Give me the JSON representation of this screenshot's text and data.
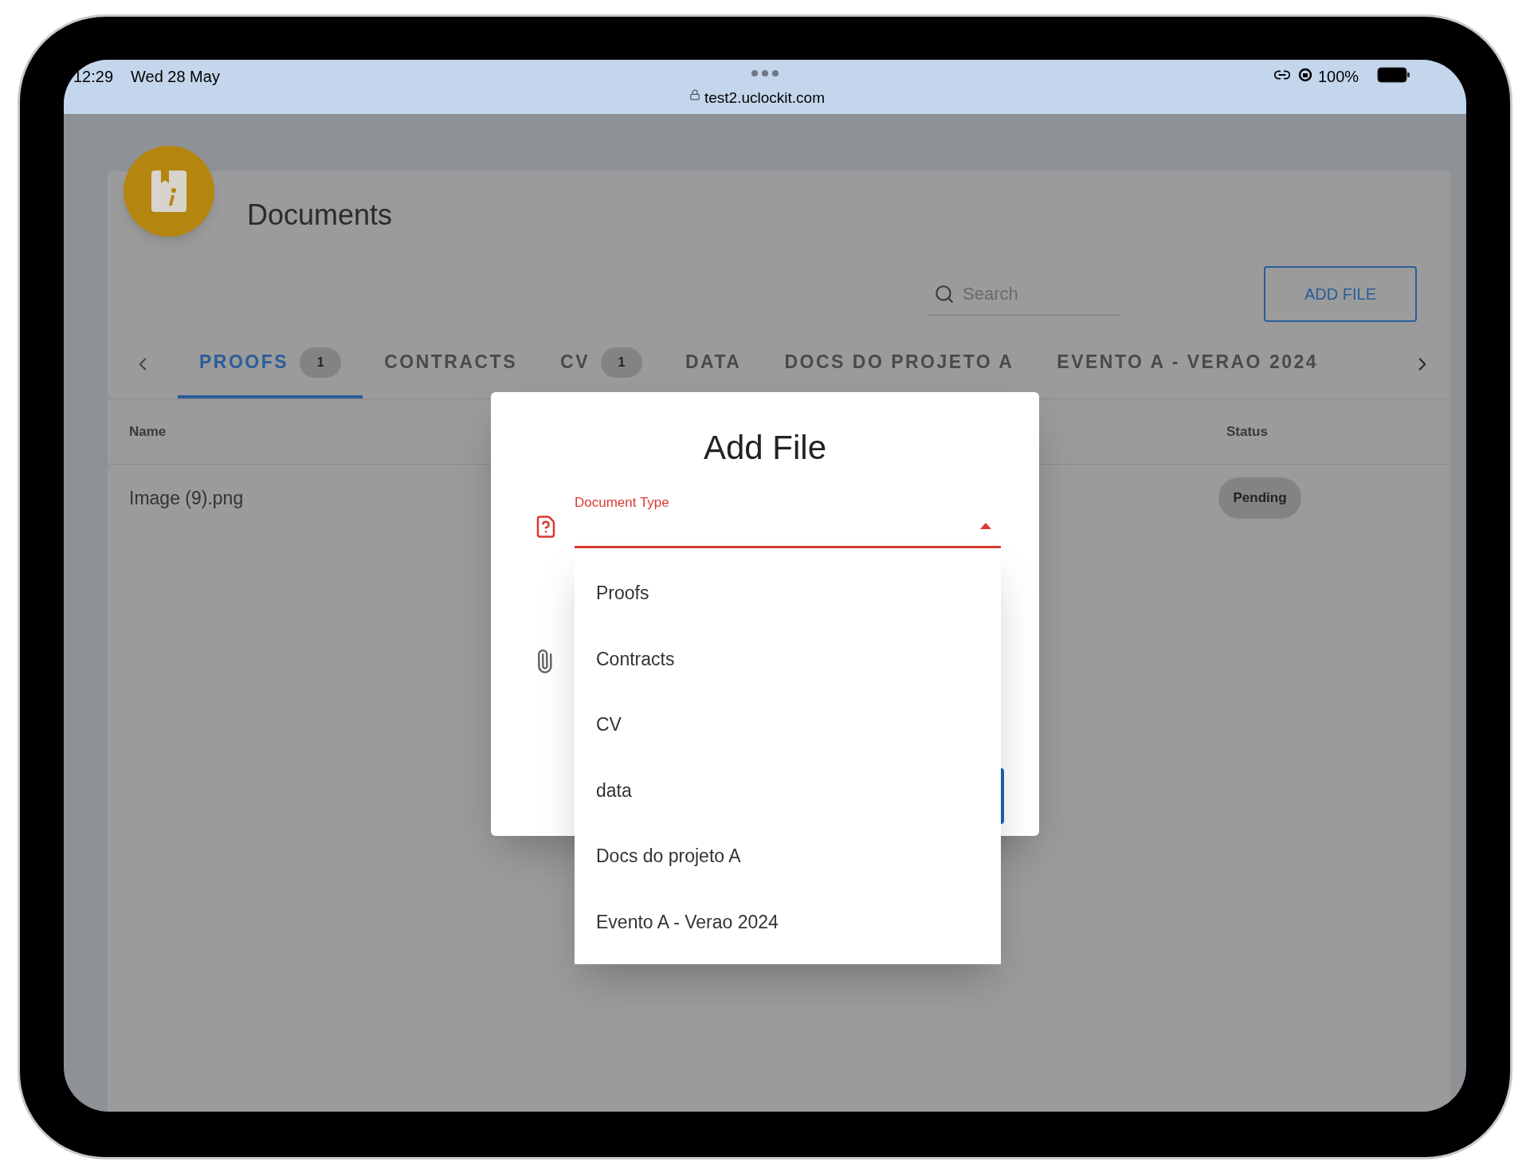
{
  "status_bar": {
    "time": "12:29",
    "date": "Wed 28 May",
    "url": "test2.uclockit.com",
    "battery": "100%"
  },
  "page": {
    "title": "Documents",
    "search": {
      "placeholder": "Search"
    },
    "add_button": "ADD FILE",
    "tabs": [
      {
        "label": "PROOFS",
        "count": "1",
        "selected": true
      },
      {
        "label": "CONTRACTS",
        "selected": false
      },
      {
        "label": "CV",
        "count": "1",
        "selected": false
      },
      {
        "label": "DATA",
        "selected": false
      },
      {
        "label": "DOCS DO PROJETO A",
        "selected": false
      },
      {
        "label": "EVENTO A - VERAO 2024",
        "selected": false
      }
    ],
    "table": {
      "columns": [
        "Name",
        "Status"
      ],
      "rows": [
        {
          "name": "Image (9).png",
          "status": "Pending"
        }
      ]
    }
  },
  "dialog": {
    "title": "Add File",
    "field": {
      "label": "Document Type",
      "expanded": true
    },
    "options": [
      "Proofs",
      "Contracts",
      "CV",
      "data",
      "Docs do projeto A",
      "Evento A - Verao 2024"
    ]
  }
}
